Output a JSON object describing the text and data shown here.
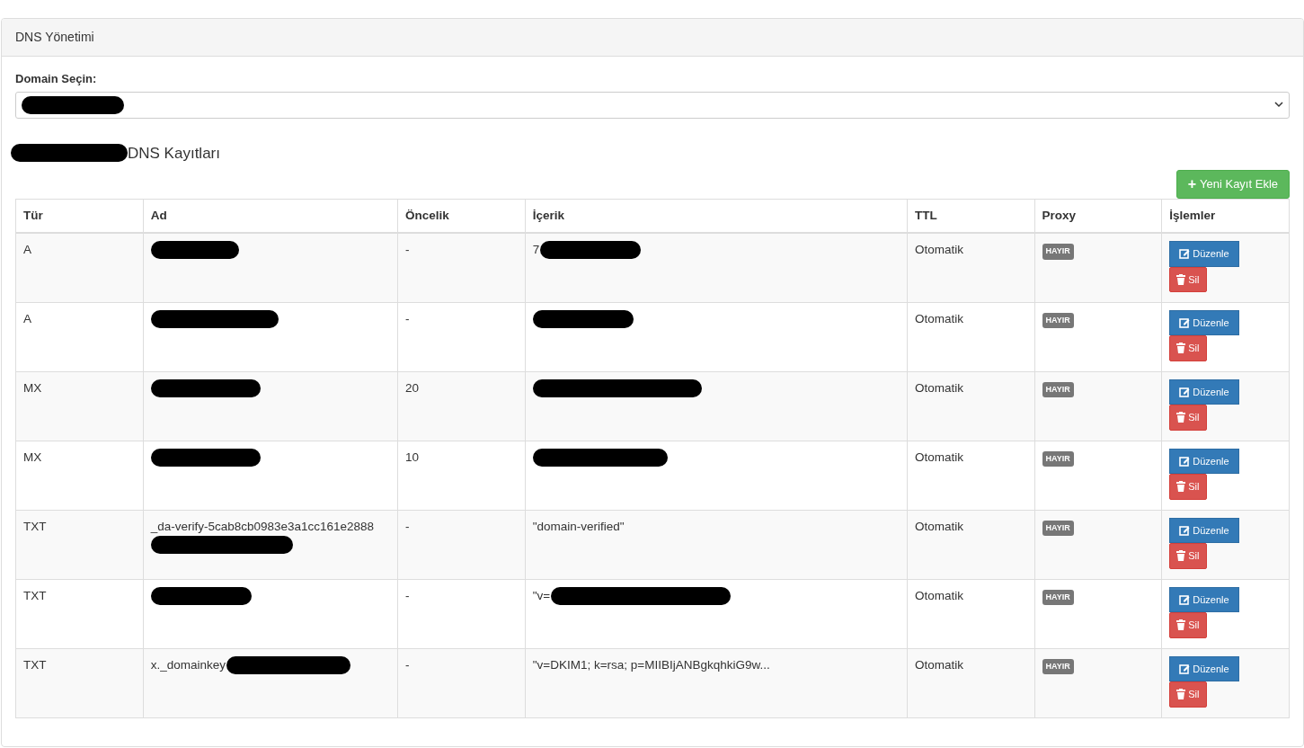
{
  "panel": {
    "title": "DNS Yönetimi"
  },
  "domain_select": {
    "label": "Domain Seçin:",
    "value_redacted": true
  },
  "records_heading": {
    "prefix_redacted": true,
    "text": "DNS Kayıtları"
  },
  "add_button": {
    "icon": "+",
    "label": "Yeni Kayıt Ekle"
  },
  "table": {
    "columns": [
      "Tür",
      "Ad",
      "Öncelik",
      "İçerik",
      "TTL",
      "Proxy",
      "İşlemler"
    ],
    "rows": [
      {
        "type": "A",
        "name": {
          "redacted": true
        },
        "priority": "-",
        "content": {
          "text": "7",
          "redacted": true
        },
        "ttl": "Otomatik",
        "proxy": "HAYIR",
        "edit": "Düzenle",
        "delete": "Sil"
      },
      {
        "type": "A",
        "name": {
          "redacted": true
        },
        "priority": "-",
        "content": {
          "redacted": true
        },
        "ttl": "Otomatik",
        "proxy": "HAYIR",
        "edit": "Düzenle",
        "delete": "Sil"
      },
      {
        "type": "MX",
        "name": {
          "redacted": true
        },
        "priority": "20",
        "content": {
          "redacted": true
        },
        "ttl": "Otomatik",
        "proxy": "HAYIR",
        "edit": "Düzenle",
        "delete": "Sil"
      },
      {
        "type": "MX",
        "name": {
          "redacted": true
        },
        "priority": "10",
        "content": {
          "redacted": true
        },
        "ttl": "Otomatik",
        "proxy": "HAYIR",
        "edit": "Düzenle",
        "delete": "Sil"
      },
      {
        "type": "TXT",
        "name": {
          "text": "_da-verify-5cab8cb0983e3a1cc161e2888",
          "redacted": true
        },
        "priority": "-",
        "content": {
          "text": "\"domain-verified\""
        },
        "ttl": "Otomatik",
        "proxy": "HAYIR",
        "edit": "Düzenle",
        "delete": "Sil"
      },
      {
        "type": "TXT",
        "name": {
          "redacted": true
        },
        "priority": "-",
        "content": {
          "text": "\"v=",
          "redacted": true
        },
        "ttl": "Otomatik",
        "proxy": "HAYIR",
        "edit": "Düzenle",
        "delete": "Sil"
      },
      {
        "type": "TXT",
        "name": {
          "text": "x._domainkey",
          "redacted": true
        },
        "priority": "-",
        "content": {
          "text": "\"v=DKIM1; k=rsa; p=MIIBIjANBgkqhkiG9w..."
        },
        "ttl": "Otomatik",
        "proxy": "HAYIR",
        "edit": "Düzenle",
        "delete": "Sil"
      }
    ]
  }
}
